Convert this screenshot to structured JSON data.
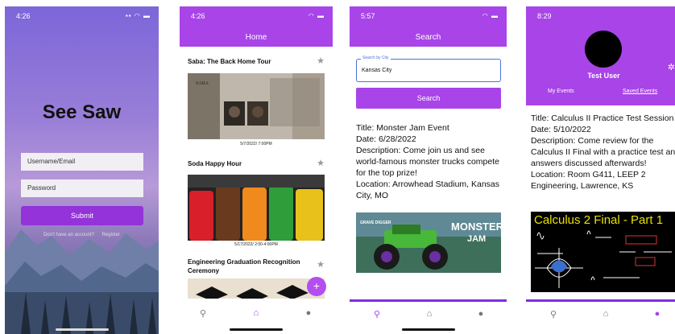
{
  "login": {
    "time": "4:26",
    "title": "See Saw",
    "username_placeholder": "Username/Email",
    "password_placeholder": "Password",
    "submit_label": "Submit",
    "no_account_text": "Don't have an account?",
    "register_label": "Register"
  },
  "home": {
    "time": "4:26",
    "title": "Home",
    "events": [
      {
        "title": "Saba: The Back Home Tour",
        "caption": "5/7/2022/ 7:00PM"
      },
      {
        "title": "Soda Happy Hour",
        "caption": "5/17/2022/ 2:00-4:00PM"
      },
      {
        "title": "Engineering Graduation Recognition Ceremony",
        "caption": ""
      }
    ],
    "fab_label": "+"
  },
  "search": {
    "time": "5:57",
    "title": "Search",
    "field_label": "Search by City",
    "field_value": "Kansas City",
    "button_label": "Search",
    "result": {
      "title": "Title: Monster Jam Event",
      "date": "Date: 6/28/2022",
      "description": "Description: Come join us and see world-famous monster trucks compete for the top prize!",
      "location": "Location: Arrowhead Stadium, Kansas City, MO"
    },
    "image_text_1": "MONSTER",
    "image_text_2": "JAM",
    "image_small_text": "GRAVE DIGGER"
  },
  "profile": {
    "time": "8:29",
    "username": "Test User",
    "tab_my_events": "My Events",
    "tab_saved_events": "Saved Events",
    "event": {
      "title": "Title: Calculus II Practice Test Session",
      "date": "Date: 5/10/2022",
      "description": "Description: Come review for the Calculus II Final with a practice test and answers discussed afterwards!",
      "location": "Location: Room G411, LEEP 2 Engineering, Lawrence, KS"
    },
    "image_title": "Calculus 2 Final - Part 1"
  },
  "colors": {
    "accent": "#a844e8",
    "tab_bar_line": "#7b2fe0",
    "input_focus": "#4a72d9"
  },
  "icons": {
    "search": "search-icon",
    "home": "home-icon",
    "profile": "person-icon",
    "star": "star-icon",
    "gear": "gear-icon"
  }
}
